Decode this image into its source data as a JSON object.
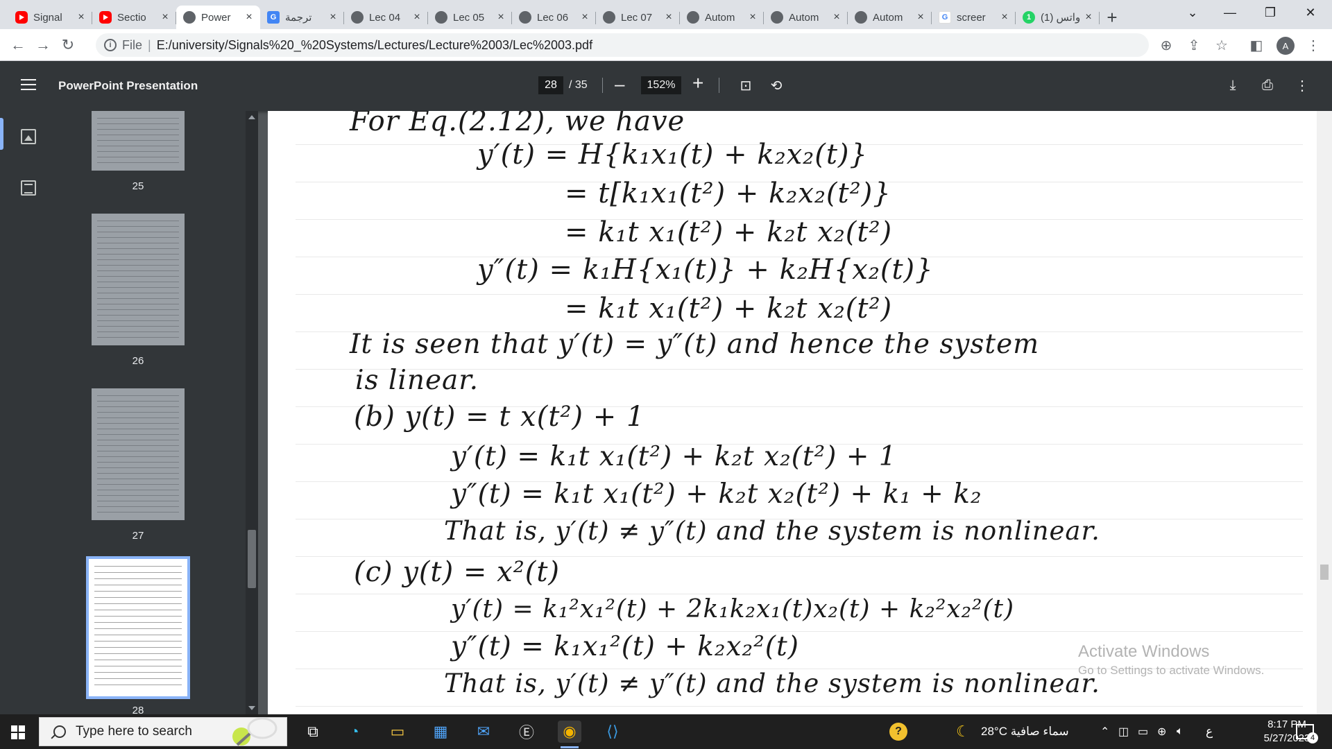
{
  "browser": {
    "tabs": [
      {
        "title": "Signal",
        "icon": "youtube-icon"
      },
      {
        "title": "Sectio",
        "icon": "youtube-icon"
      },
      {
        "title": "Power",
        "icon": "globe-icon",
        "active": true
      },
      {
        "title": "ترجمة",
        "icon": "google-translate-icon"
      },
      {
        "title": "Lec 04",
        "icon": "globe-icon"
      },
      {
        "title": "Lec 05",
        "icon": "globe-icon"
      },
      {
        "title": "Lec 06",
        "icon": "globe-icon"
      },
      {
        "title": "Lec 07",
        "icon": "globe-icon"
      },
      {
        "title": "Autom",
        "icon": "globe-icon"
      },
      {
        "title": "Autom",
        "icon": "globe-icon"
      },
      {
        "title": "Autom",
        "icon": "globe-icon"
      },
      {
        "title": "screer",
        "icon": "google-icon"
      },
      {
        "title": "واتس (1)",
        "icon": "whatsapp-icon"
      }
    ],
    "new_tab": "+",
    "address": {
      "scheme_label": "File",
      "url": "E:/university/Signals%20_%20Systems/Lectures/Lecture%2003/Lec%2003.pdf"
    },
    "profile_initial": "A"
  },
  "pdf_viewer": {
    "title": "PowerPoint Presentation",
    "current_page": "28",
    "total_pages": "/ 35",
    "zoom": "152%"
  },
  "thumbnails": [
    {
      "number": "25"
    },
    {
      "number": "26"
    },
    {
      "number": "27"
    },
    {
      "number": "28",
      "active": true
    }
  ],
  "page_content": {
    "lines": [
      "For Eq.(2.12), we have",
      "y′(t) = H{k₁x₁(t) + k₂x₂(t)}",
      "= t[k₁x₁(t²) + k₂x₂(t²)}",
      "= k₁t x₁(t²) + k₂t x₂(t²)",
      "y″(t) = k₁H{x₁(t)} + k₂H{x₂(t)}",
      "= k₁t x₁(t²) + k₂t x₂(t²)",
      "It is seen that y′(t) = y″(t) and hence the system",
      "is linear.",
      "(b)  y(t) = t x(t²) + 1",
      "y′(t) = k₁t x₁(t²) + k₂t x₂(t²) + 1",
      "y″(t) = k₁t x₁(t²) + k₂t x₂(t²) + k₁ + k₂",
      "That is, y′(t) ≠ y″(t) and the system is nonlinear.",
      "(c)  y(t) = x²(t)",
      "y′(t) = k₁²x₁²(t) + 2k₁k₂x₁(t)x₂(t) + k₂²x₂²(t)",
      "y″(t) = k₁x₁²(t) + k₂x₂²(t)",
      "That is, y′(t) ≠ y″(t) and the system is nonlinear."
    ],
    "watermark_title": "Activate Windows",
    "watermark_sub": "Go to Settings to activate Windows."
  },
  "taskbar": {
    "search_placeholder": "Type here to search",
    "weather": "28°C  سماء صافية",
    "lang": "ع",
    "time": "8:17 PM",
    "date": "5/27/2023",
    "notifications": "4"
  }
}
